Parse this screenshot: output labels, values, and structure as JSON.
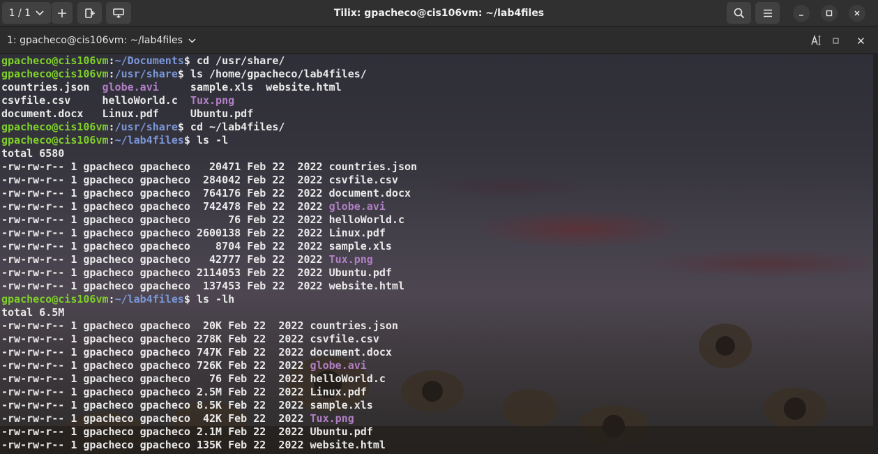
{
  "header": {
    "session_label": "1 / 1",
    "title": "Tilix: gpacheco@cis106vm: ~/lab4files"
  },
  "terminal_bar": {
    "title": "1: gpacheco@cis106vm: ~/lab4files"
  },
  "colors": {
    "user_host": "#7fcf2a",
    "path": "#7b97d8",
    "media_file": "#b17fc4",
    "text": "#eaeaea"
  },
  "lines": [
    [
      {
        "t": "gpacheco@cis106vm",
        "c": "u"
      },
      {
        "t": ":"
      },
      {
        "t": "~/Documents",
        "c": "p"
      },
      {
        "t": "$ cd /usr/share/"
      }
    ],
    [
      {
        "t": "gpacheco@cis106vm",
        "c": "u"
      },
      {
        "t": ":"
      },
      {
        "t": "/usr/share",
        "c": "p"
      },
      {
        "t": "$ ls /home/gpacheco/lab4files/"
      }
    ],
    [
      {
        "t": "countries.json  "
      },
      {
        "t": "globe.avi",
        "c": "m"
      },
      {
        "t": "     sample.xls  website.html"
      }
    ],
    [
      {
        "t": "csvfile.csv     helloWorld.c  "
      },
      {
        "t": "Tux.png",
        "c": "m"
      }
    ],
    [
      {
        "t": "document.docx   Linux.pdf     Ubuntu.pdf"
      }
    ],
    [
      {
        "t": "gpacheco@cis106vm",
        "c": "u"
      },
      {
        "t": ":"
      },
      {
        "t": "/usr/share",
        "c": "p"
      },
      {
        "t": "$ cd ~/lab4files/"
      }
    ],
    [
      {
        "t": "gpacheco@cis106vm",
        "c": "u"
      },
      {
        "t": ":"
      },
      {
        "t": "~/lab4files",
        "c": "p"
      },
      {
        "t": "$ ls -l"
      }
    ],
    [
      {
        "t": "total 6580"
      }
    ],
    [
      {
        "t": "-rw-rw-r-- 1 gpacheco gpacheco   20471 Feb 22  2022 countries.json"
      }
    ],
    [
      {
        "t": "-rw-rw-r-- 1 gpacheco gpacheco  284042 Feb 22  2022 csvfile.csv"
      }
    ],
    [
      {
        "t": "-rw-rw-r-- 1 gpacheco gpacheco  764176 Feb 22  2022 document.docx"
      }
    ],
    [
      {
        "t": "-rw-rw-r-- 1 gpacheco gpacheco  742478 Feb 22  2022 "
      },
      {
        "t": "globe.avi",
        "c": "m"
      }
    ],
    [
      {
        "t": "-rw-rw-r-- 1 gpacheco gpacheco      76 Feb 22  2022 helloWorld.c"
      }
    ],
    [
      {
        "t": "-rw-rw-r-- 1 gpacheco gpacheco 2600138 Feb 22  2022 Linux.pdf"
      }
    ],
    [
      {
        "t": "-rw-rw-r-- 1 gpacheco gpacheco    8704 Feb 22  2022 sample.xls"
      }
    ],
    [
      {
        "t": "-rw-rw-r-- 1 gpacheco gpacheco   42777 Feb 22  2022 "
      },
      {
        "t": "Tux.png",
        "c": "m"
      }
    ],
    [
      {
        "t": "-rw-rw-r-- 1 gpacheco gpacheco 2114053 Feb 22  2022 Ubuntu.pdf"
      }
    ],
    [
      {
        "t": "-rw-rw-r-- 1 gpacheco gpacheco  137453 Feb 22  2022 website.html"
      }
    ],
    [
      {
        "t": "gpacheco@cis106vm",
        "c": "u"
      },
      {
        "t": ":"
      },
      {
        "t": "~/lab4files",
        "c": "p"
      },
      {
        "t": "$ ls -lh"
      }
    ],
    [
      {
        "t": "total 6.5M"
      }
    ],
    [
      {
        "t": "-rw-rw-r-- 1 gpacheco gpacheco  20K Feb 22  2022 countries.json"
      }
    ],
    [
      {
        "t": "-rw-rw-r-- 1 gpacheco gpacheco 278K Feb 22  2022 csvfile.csv"
      }
    ],
    [
      {
        "t": "-rw-rw-r-- 1 gpacheco gpacheco 747K Feb 22  2022 document.docx"
      }
    ],
    [
      {
        "t": "-rw-rw-r-- 1 gpacheco gpacheco 726K Feb 22  2022 "
      },
      {
        "t": "globe.avi",
        "c": "m"
      }
    ],
    [
      {
        "t": "-rw-rw-r-- 1 gpacheco gpacheco   76 Feb 22  2022 helloWorld.c"
      }
    ],
    [
      {
        "t": "-rw-rw-r-- 1 gpacheco gpacheco 2.5M Feb 22  2022 Linux.pdf"
      }
    ],
    [
      {
        "t": "-rw-rw-r-- 1 gpacheco gpacheco 8.5K Feb 22  2022 sample.xls"
      }
    ],
    [
      {
        "t": "-rw-rw-r-- 1 gpacheco gpacheco  42K Feb 22  2022 "
      },
      {
        "t": "Tux.png",
        "c": "m"
      }
    ],
    [
      {
        "t": "-rw-rw-r-- 1 gpacheco gpacheco 2.1M Feb 22  2022 Ubuntu.pdf"
      }
    ],
    [
      {
        "t": "-rw-rw-r-- 1 gpacheco gpacheco 135K Feb 22  2022 website.html"
      }
    ]
  ]
}
